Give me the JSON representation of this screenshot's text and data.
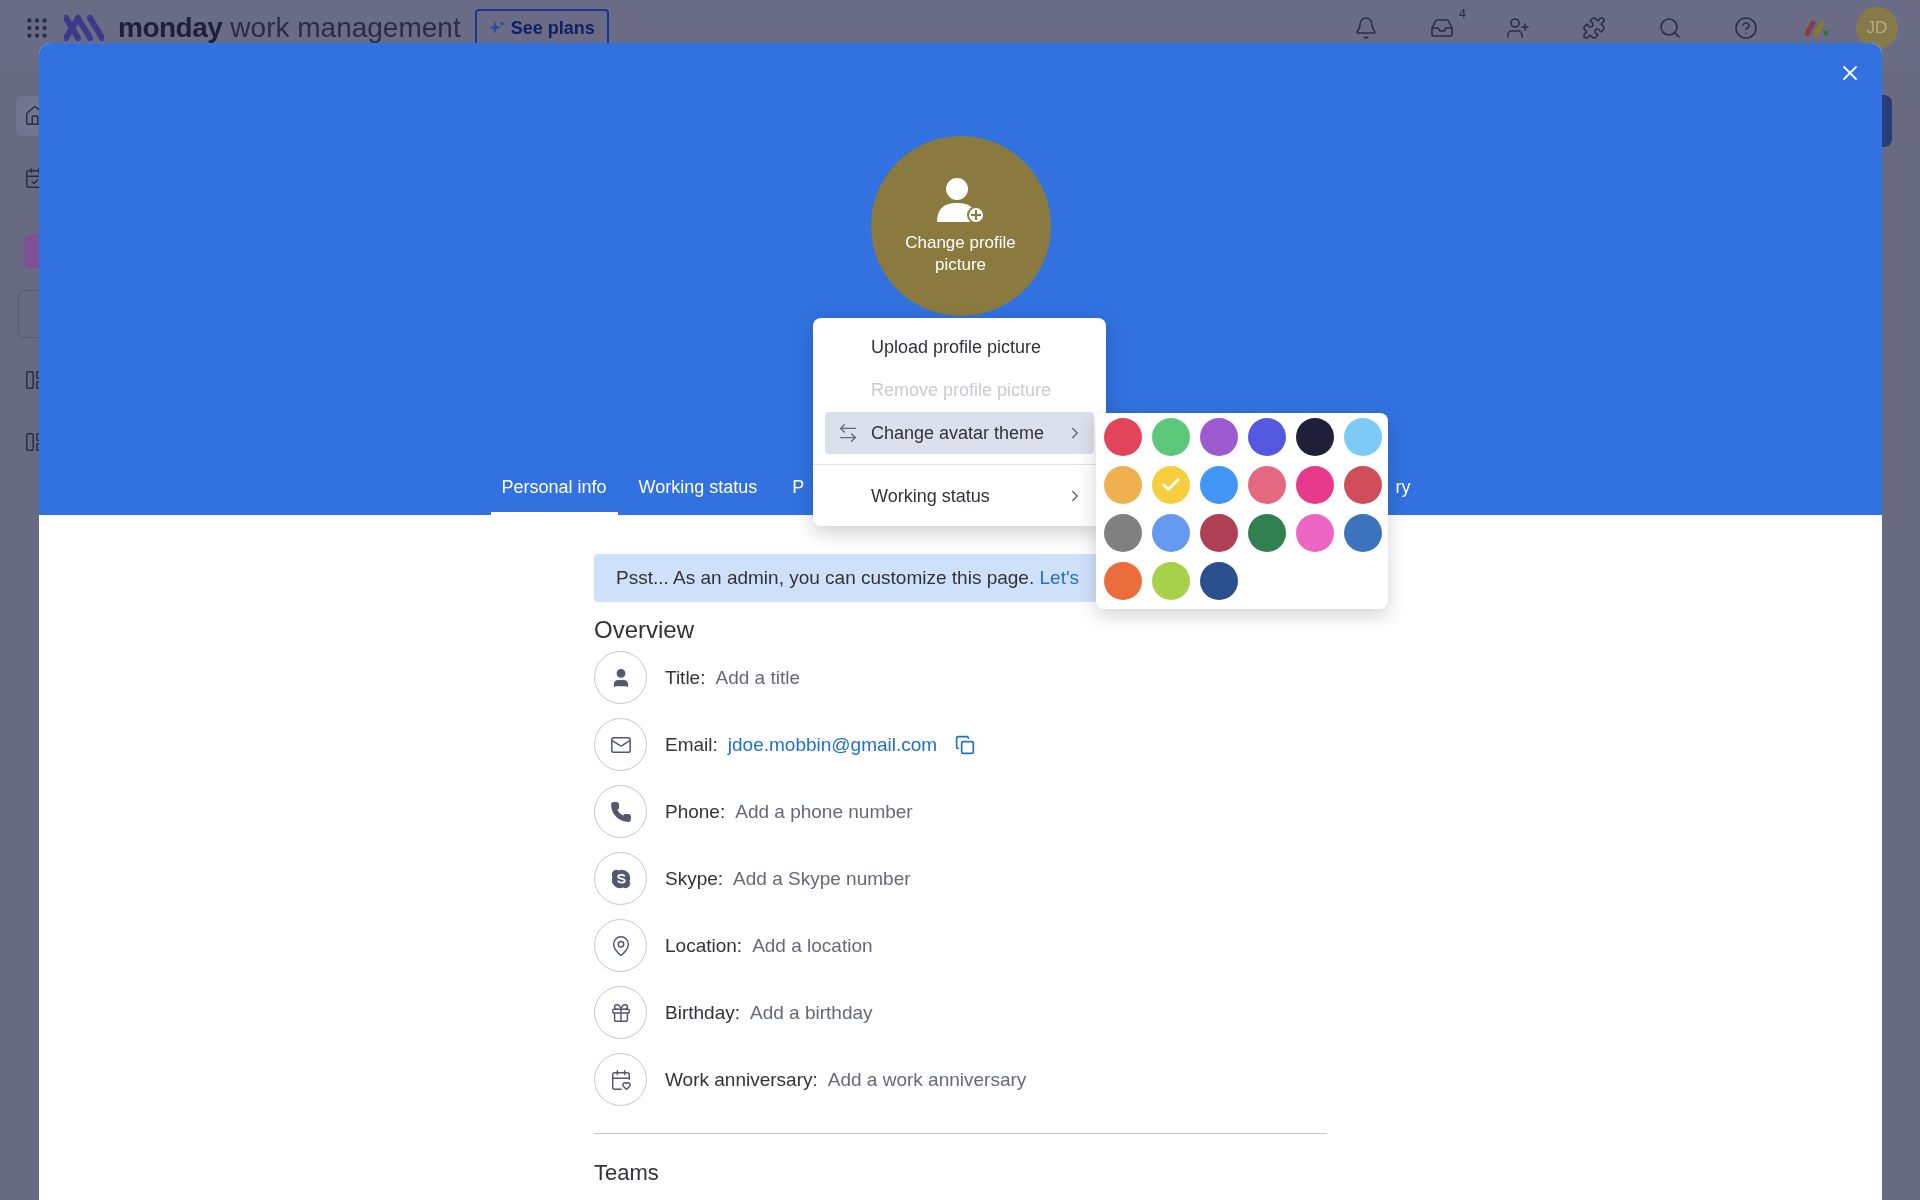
{
  "app_bar": {
    "brand": "monday",
    "product": "work management",
    "plans_button": "See plans",
    "inbox_badge": "4",
    "avatar_initials": "JD"
  },
  "profile": {
    "avatar_overlay": "Change profile picture",
    "tabs": [
      {
        "label": "Personal info",
        "selected": true
      },
      {
        "label": "Working status",
        "selected": false
      },
      {
        "label": "P",
        "selected": false
      },
      {
        "label": "ry",
        "selected": false
      }
    ]
  },
  "avatar_menu": {
    "items": [
      {
        "label": "Upload profile picture",
        "disabled": false,
        "highlighted": false,
        "submenu": false
      },
      {
        "label": "Remove profile picture",
        "disabled": true,
        "highlighted": false,
        "submenu": false
      },
      {
        "label": "Change avatar theme",
        "disabled": false,
        "highlighted": true,
        "submenu": true
      },
      {
        "label": "Working status",
        "disabled": false,
        "highlighted": false,
        "submenu": true
      }
    ]
  },
  "theme_palette": [
    {
      "color": "#e2445c",
      "selected": false
    },
    {
      "color": "#5cc879",
      "selected": false
    },
    {
      "color": "#9d5bd2",
      "selected": false
    },
    {
      "color": "#5559df",
      "selected": false
    },
    {
      "color": "#1f1f3a",
      "selected": false
    },
    {
      "color": "#7dc9f8",
      "selected": false
    },
    {
      "color": "#efb04f",
      "selected": false
    },
    {
      "color": "#f7ce3f",
      "selected": true
    },
    {
      "color": "#4196f6",
      "selected": false
    },
    {
      "color": "#e4687f",
      "selected": false
    },
    {
      "color": "#e73a8a",
      "selected": false
    },
    {
      "color": "#d04d5c",
      "selected": false
    },
    {
      "color": "#808080",
      "selected": false
    },
    {
      "color": "#6699f0",
      "selected": false
    },
    {
      "color": "#ae3f55",
      "selected": false
    },
    {
      "color": "#327f52",
      "selected": false
    },
    {
      "color": "#ee66c4",
      "selected": false
    },
    {
      "color": "#3b73bd",
      "selected": false
    },
    {
      "color": "#ec6d3c",
      "selected": false
    },
    {
      "color": "#a8d14b",
      "selected": false
    },
    {
      "color": "#2b4e8f",
      "selected": false
    }
  ],
  "admin_banner": {
    "text": "Psst... As an admin, you can customize this page.",
    "link": "Let's"
  },
  "overview": {
    "heading": "Overview",
    "fields": [
      {
        "kind": "title",
        "label": "Title:",
        "value": "Add a title"
      },
      {
        "kind": "email",
        "label": "Email:",
        "value": "jdoe.mobbin@gmail.com"
      },
      {
        "kind": "phone",
        "label": "Phone:",
        "value": "Add a phone number"
      },
      {
        "kind": "skype",
        "label": "Skype:",
        "value": "Add a Skype number"
      },
      {
        "kind": "location",
        "label": "Location:",
        "value": "Add a location"
      },
      {
        "kind": "birthday",
        "label": "Birthday:",
        "value": "Add a birthday"
      },
      {
        "kind": "anniversary",
        "label": "Work anniversary:",
        "value": "Add a work anniversary"
      }
    ]
  },
  "teams": {
    "heading": "Teams"
  }
}
